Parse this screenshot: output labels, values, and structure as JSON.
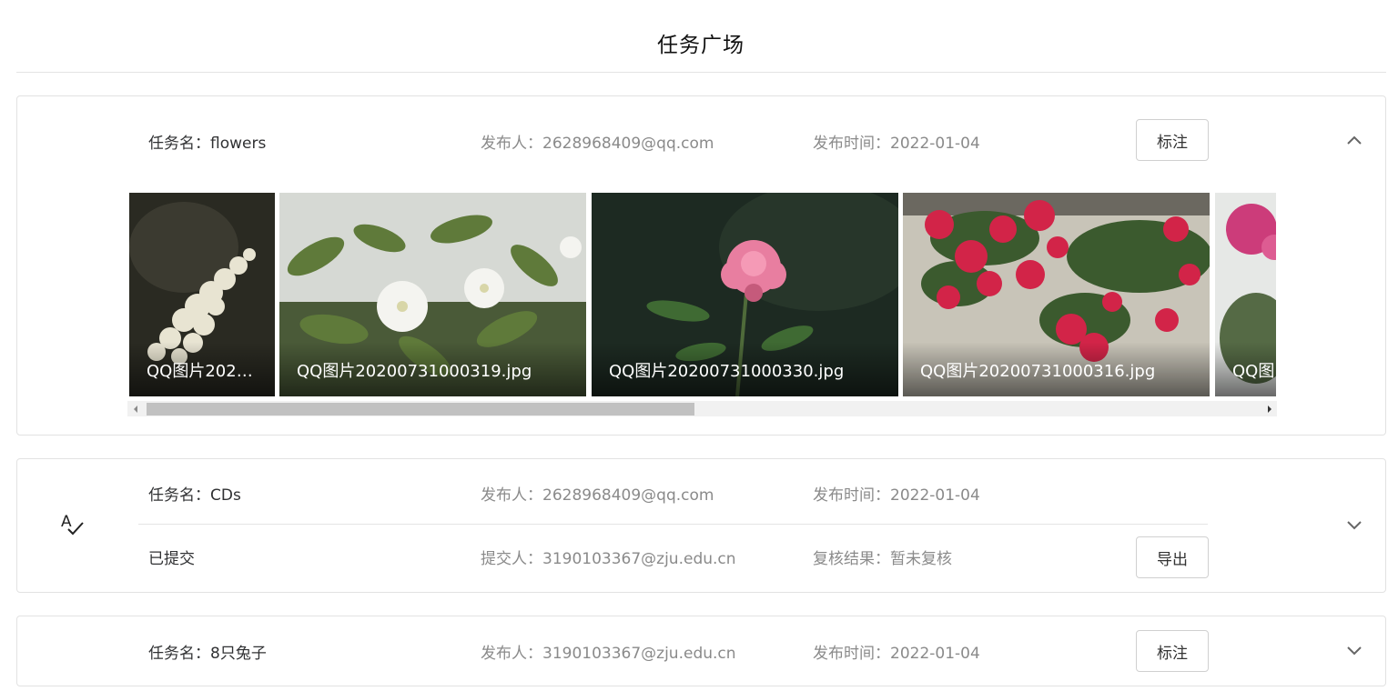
{
  "page": {
    "title": "任务广场"
  },
  "tasks": [
    {
      "name_label": "任务名：",
      "name": "flowers",
      "publisher_label": "发布人：",
      "publisher": "2628968409@qq.com",
      "time_label": "发布时间：",
      "time": "2022-01-04",
      "button_label": "标注",
      "expanded": true,
      "images": [
        {
          "caption": "QQ图片202…",
          "icon": "flower-photo"
        },
        {
          "caption": "QQ图片20200731000319.jpg",
          "icon": "flower-photo"
        },
        {
          "caption": "QQ图片20200731000330.jpg",
          "icon": "flower-photo"
        },
        {
          "caption": "QQ图片20200731000316.jpg",
          "icon": "flower-photo"
        },
        {
          "caption": "QQ图",
          "icon": "flower-photo"
        }
      ]
    },
    {
      "name_label": "任务名：",
      "name": "CDs",
      "publisher_label": "发布人：",
      "publisher": "2628968409@qq.com",
      "time_label": "发布时间：",
      "time": "2022-01-04",
      "status": "已提交",
      "submitter_label": "提交人：",
      "submitter": "3190103367@zju.edu.cn",
      "review_label": "复核结果：",
      "review": "暂未复核",
      "button_label": "导出",
      "expanded": false,
      "icon": "spellcheck-icon"
    },
    {
      "name_label": "任务名：",
      "name": "8只兔子",
      "publisher_label": "发布人：",
      "publisher": "3190103367@zju.edu.cn",
      "time_label": "发布时间：",
      "time": "2022-01-04",
      "button_label": "标注",
      "expanded": false
    }
  ],
  "colors": {
    "muted_text": "#8a8a8a",
    "primary_text": "#303133",
    "border": "#e2e2e2"
  }
}
